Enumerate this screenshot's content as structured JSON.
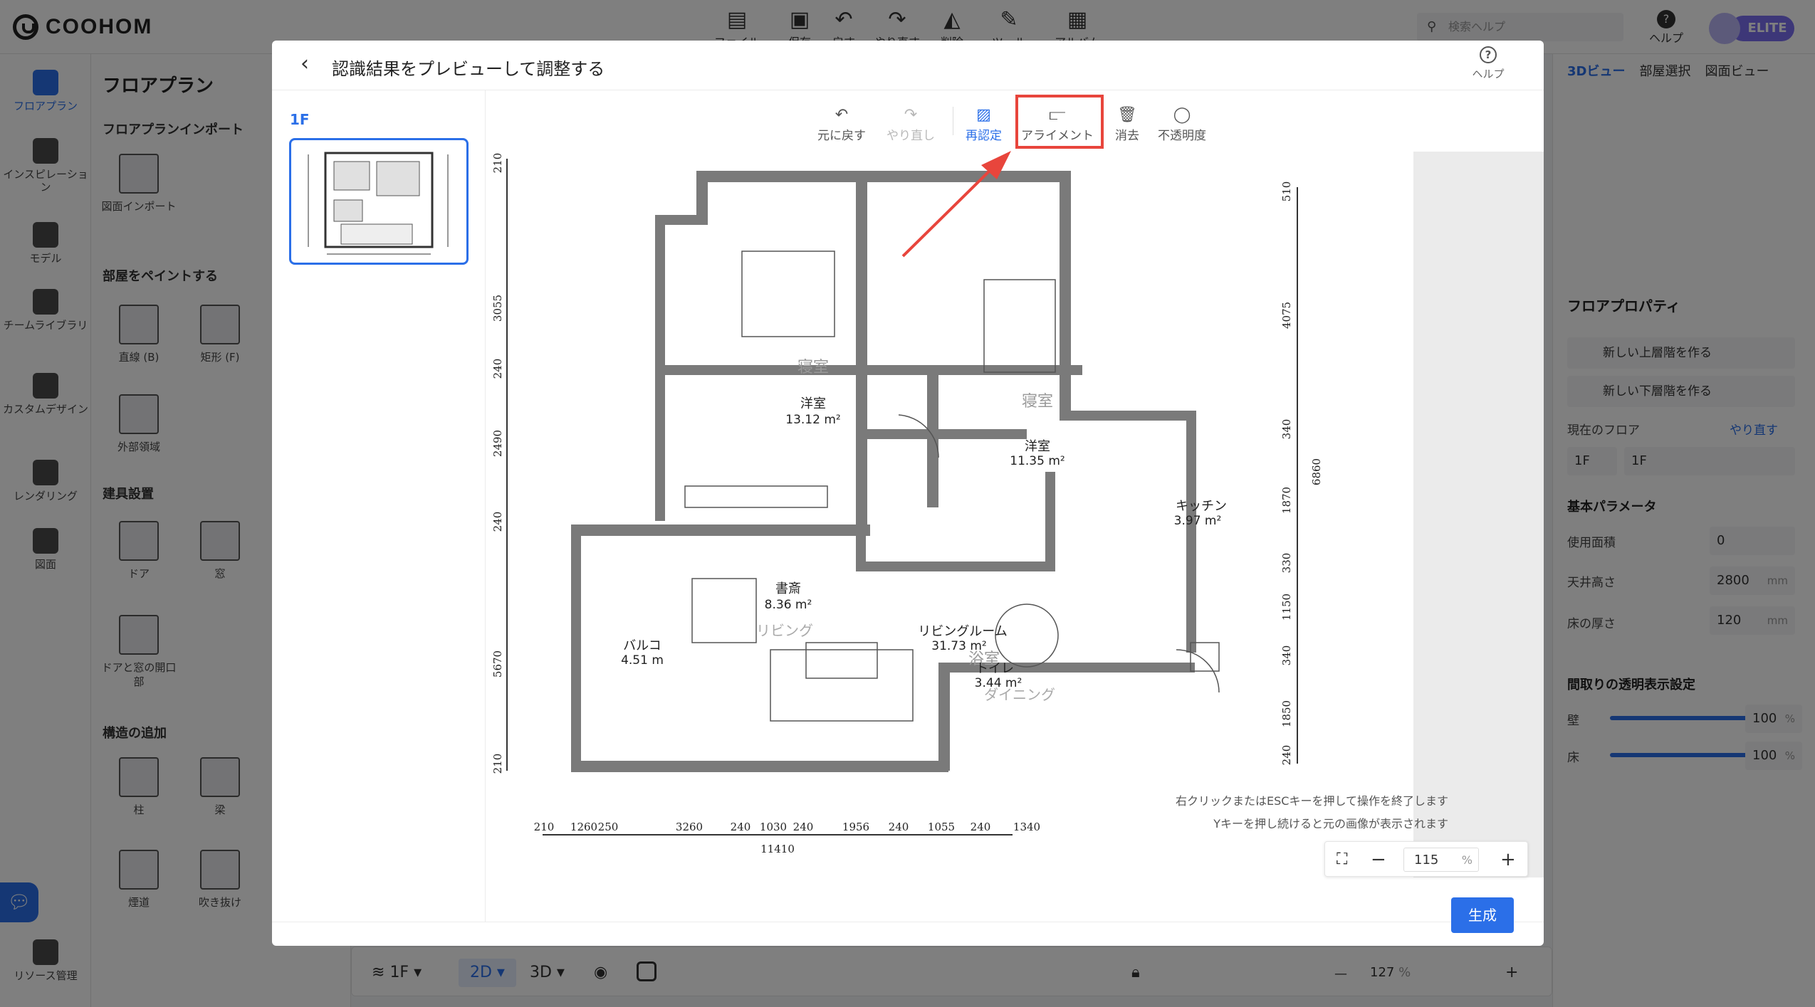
{
  "app": {
    "logo": "COOHOM",
    "toolbar": [
      {
        "label": "ファイル",
        "icon": "file-icon"
      },
      {
        "label": "保存",
        "icon": "save-icon"
      },
      {
        "label": "戻す",
        "icon": "undo-icon"
      },
      {
        "label": "やり直す",
        "icon": "redo-icon"
      },
      {
        "label": "削除",
        "icon": "eraser-icon"
      },
      {
        "label": "ツール",
        "icon": "wrench-icon"
      },
      {
        "label": "アルバム",
        "icon": "album-icon"
      }
    ],
    "search_placeholder": "検索ヘルプ",
    "help_label": "ヘルプ",
    "badge": "ELITE"
  },
  "left_rail": [
    {
      "label": "フロアプラン",
      "active": true
    },
    {
      "label": "インスピレーション"
    },
    {
      "label": "モデル"
    },
    {
      "label": "チームライブラリ"
    },
    {
      "label": "カスタムデザイン"
    },
    {
      "label": "レンダリング"
    },
    {
      "label": "図面"
    },
    {
      "label": "リソース管理"
    }
  ],
  "left_panel": {
    "title": "フロアプラン",
    "sections": {
      "import": "フロアプランインポート",
      "paint": "部屋をペイントする",
      "fixtures": "建具設置",
      "structure": "構造の追加"
    },
    "tools": {
      "import_drawing": "図面インポート",
      "line": "直線 (B)",
      "rect": "矩形 (F)",
      "outer": "外部領域",
      "door": "ドア",
      "window": "窓",
      "door_opening": "ドアと窓の開口部",
      "column": "柱",
      "beam": "梁",
      "flue": "煙道",
      "void": "吹き抜け"
    }
  },
  "right_panel": {
    "tabs": [
      "3Dビュー",
      "部屋選択",
      "図面ビュー"
    ],
    "floor_props_title": "フロアプロパティ",
    "new_upper": "新しい上層階を作る",
    "new_lower": "新しい下層階を作る",
    "current_floor_label": "現在のフロア",
    "current_floor_action": "やり直す",
    "current_floor_index": "1F",
    "current_floor_name": "1F",
    "basic_params": "基本パラメータ",
    "area_label": "使用面積",
    "area_value": "0",
    "ceiling_label": "天井高さ",
    "ceiling_value": "2800",
    "floor_thickness_label": "床の厚さ",
    "floor_thickness_value": "120",
    "unit_mm": "mm",
    "transparency_title": "間取りの透明表示設定",
    "wall_label": "壁",
    "wall_value": "100",
    "wall_level": 1.0,
    "floor_label": "床",
    "floor_value": "100",
    "floor_level": 1.0,
    "percent": "%"
  },
  "bottom_bar": {
    "floor": "1F",
    "mode_2d": "2D",
    "mode_3d": "3D",
    "zoom": "127",
    "percent": "%"
  },
  "modal": {
    "title": "認識結果をプレビューして調整する",
    "help": "ヘルプ",
    "floor_tab": "1F",
    "toolbar": {
      "undo": "元に戻す",
      "redo": "やり直し",
      "recognize": "再認定",
      "align": "アライメント",
      "erase": "消去",
      "opacity": "不透明度"
    },
    "hint_line1": "右クリックまたはESCキーを押して操作を終了します",
    "hint_line2": "Yキーを押し続けると元の画像が表示されます",
    "zoom_value": "115",
    "zoom_unit": "%",
    "generate": "生成"
  },
  "floor_plan": {
    "rooms": [
      {
        "name": "寝室",
        "sub": "洋室",
        "area": "13.12 m²"
      },
      {
        "name": "寝室",
        "sub": "洋室",
        "area": "11.35 m²"
      },
      {
        "name": "書斎",
        "area": "8.36 m²"
      },
      {
        "name": "浴室",
        "sub": "トイレ",
        "area": "3.44 m²"
      },
      {
        "name": "キッチン",
        "area": "3.97 m²"
      },
      {
        "name": "バルコ",
        "area": "4.51 m"
      },
      {
        "name": "リビング",
        "sub": "リビングルーム",
        "area": "31.73 m²"
      },
      {
        "name": "ダイニング"
      }
    ],
    "dims_bottom": [
      "210",
      "1260",
      "250",
      "3260",
      "240",
      "1030",
      "240",
      "1956",
      "240",
      "1055",
      "240",
      "1340"
    ],
    "dims_bottom_total": "11410",
    "dims_left": [
      "210",
      "3055",
      "240",
      "2490",
      "240",
      "5670",
      "210"
    ],
    "dims_right": [
      "510",
      "4075",
      "340",
      "1870",
      "330",
      "1150",
      "340",
      "1850",
      "240"
    ],
    "dims_right_total": "6860"
  }
}
